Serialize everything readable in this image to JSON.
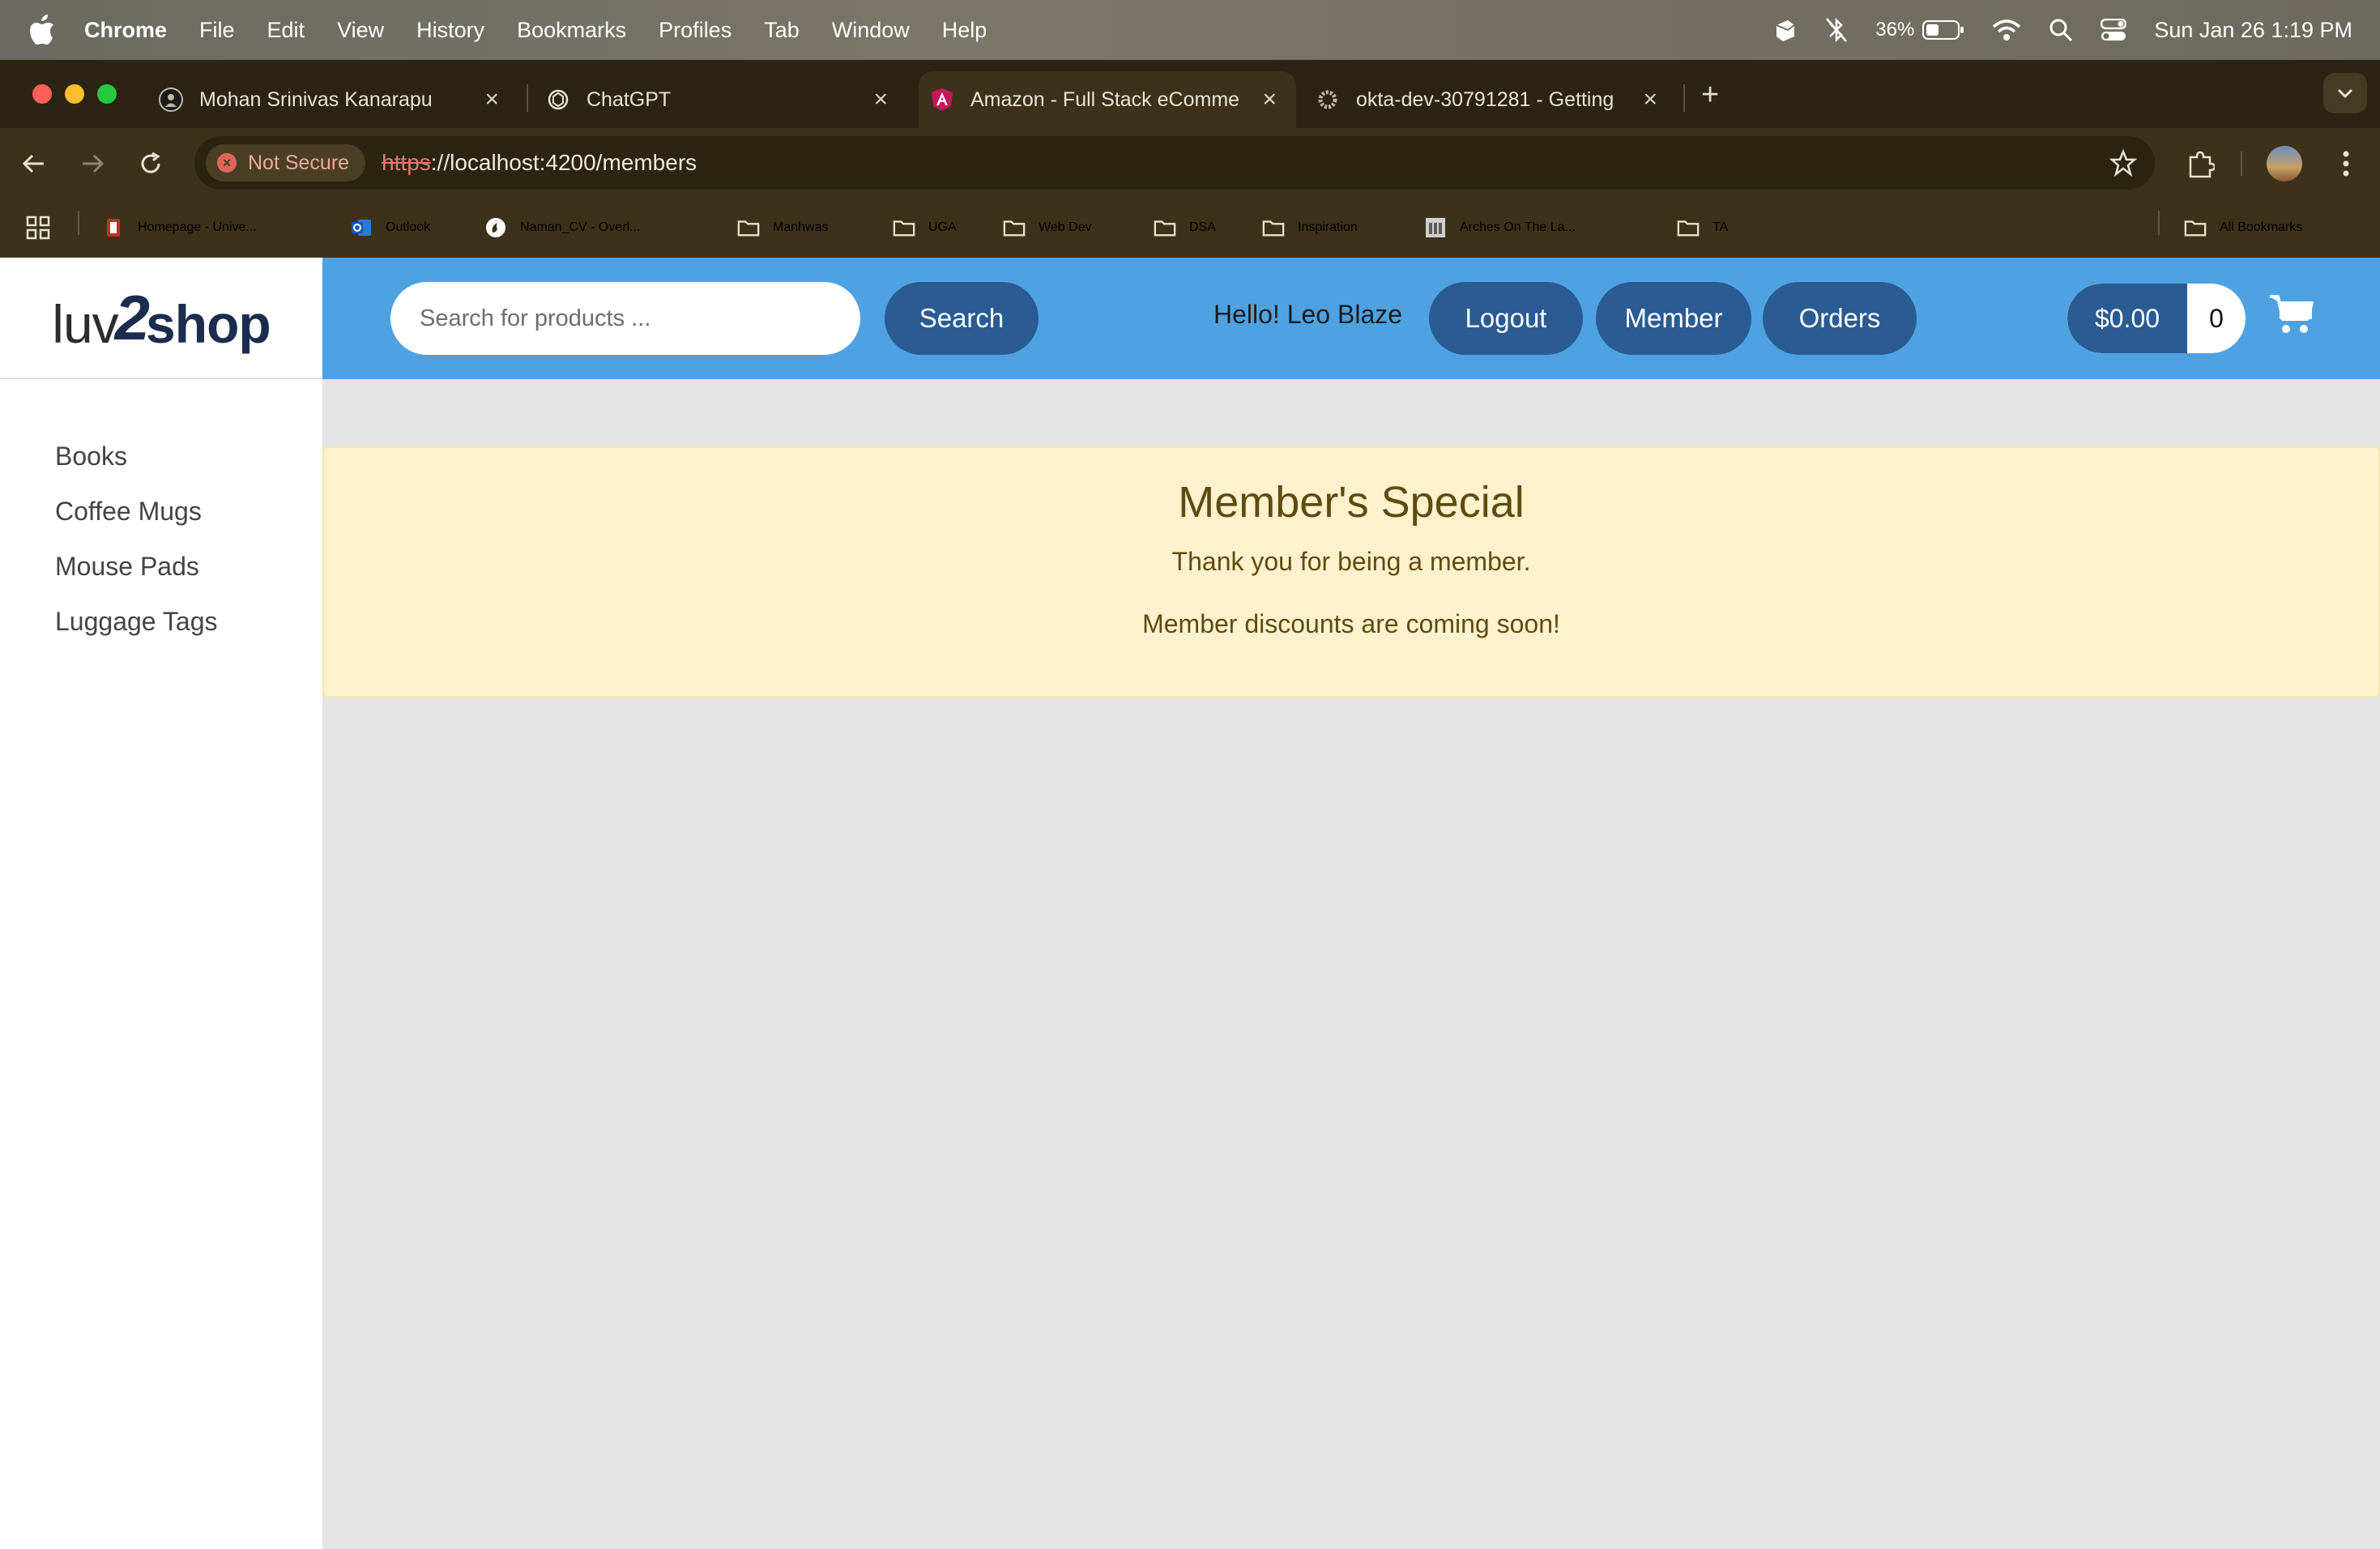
{
  "menubar": {
    "app": "Chrome",
    "items": [
      "File",
      "Edit",
      "View",
      "History",
      "Bookmarks",
      "Profiles",
      "Tab",
      "Window",
      "Help"
    ],
    "battery": "36%",
    "datetime": "Sun Jan 26  1:19 PM"
  },
  "tabs": [
    {
      "title": "Mohan Srinivas Kanarapu"
    },
    {
      "title": "ChatGPT"
    },
    {
      "title": "Amazon - Full Stack eComme"
    },
    {
      "title": "okta-dev-30791281 - Getting"
    }
  ],
  "address": {
    "security": "Not Secure",
    "scheme": "https",
    "rest": "://localhost:4200/members"
  },
  "bookmarks": [
    "Homepage - Unive...",
    "Outlook",
    "Naman_CV - Overl...",
    "Manhwas",
    "UGA",
    "Web Dev",
    "DSA",
    "Inspiration",
    "Arches On The La...",
    "TA",
    "All Bookmarks"
  ],
  "logo": {
    "part1": "luv",
    "part2": "2",
    "part3": "shop"
  },
  "categories": [
    "Books",
    "Coffee Mugs",
    "Mouse Pads",
    "Luggage Tags"
  ],
  "header": {
    "search_placeholder": "Search for products ...",
    "search_label": "Search",
    "greeting": "Hello! Leo Blaze",
    "logout_label": "Logout",
    "member_label": "Member",
    "orders_label": "Orders",
    "cart_total": "$0.00",
    "cart_count": "0"
  },
  "banner": {
    "title": "Member's Special",
    "line1": "Thank you for being a member.",
    "line2": "Member discounts are coming soon!"
  },
  "colors": {
    "header": "#4ea2e2",
    "button": "#2a5b93",
    "banner_bg": "#fdf2cd",
    "banner_text": "#5e4b10"
  }
}
